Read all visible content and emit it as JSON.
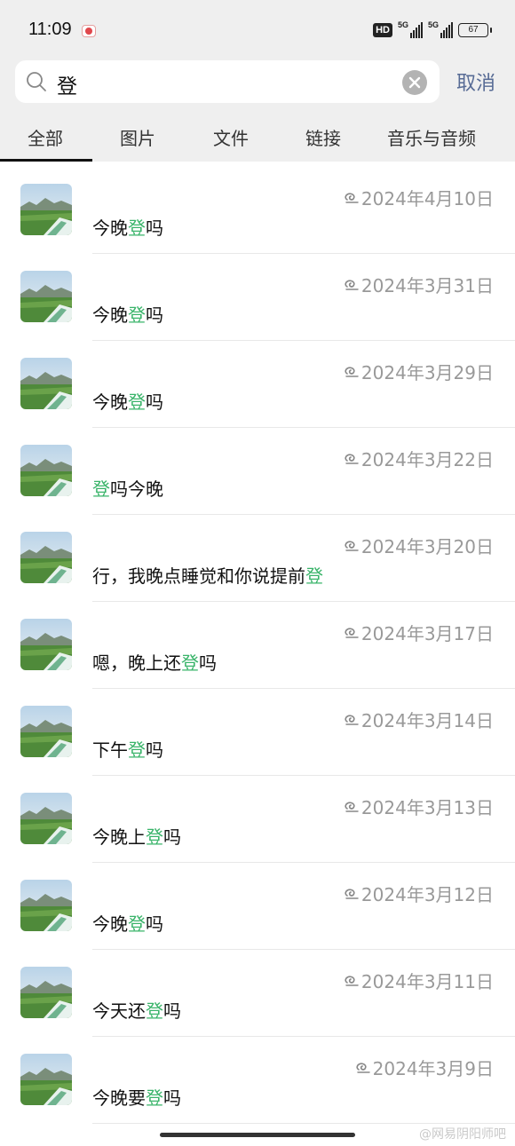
{
  "status_bar": {
    "time": "11:09",
    "hd_badge": "HD",
    "signal1_label": "5G",
    "signal2_label": "5G",
    "battery": "67"
  },
  "search": {
    "query": "登",
    "cancel_label": "取消"
  },
  "tabs": [
    {
      "label": "全部",
      "active": true
    },
    {
      "label": "图片",
      "active": false
    },
    {
      "label": "文件",
      "active": false
    },
    {
      "label": "链接",
      "active": false
    },
    {
      "label": "音乐与音频",
      "active": false
    }
  ],
  "highlight_color": "#3ab46a",
  "results": [
    {
      "date": "2024年4月10日",
      "pre": "今晚",
      "hl": "登",
      "post": "吗"
    },
    {
      "date": "2024年3月31日",
      "pre": "今晚",
      "hl": "登",
      "post": "吗"
    },
    {
      "date": "2024年3月29日",
      "pre": "今晚",
      "hl": "登",
      "post": "吗"
    },
    {
      "date": "2024年3月22日",
      "pre": "",
      "hl": "登",
      "post": "吗今晚"
    },
    {
      "date": "2024年3月20日",
      "pre": "行，我晚点睡觉和你说提前",
      "hl": "登",
      "post": ""
    },
    {
      "date": "2024年3月17日",
      "pre": "嗯，晚上还",
      "hl": "登",
      "post": "吗"
    },
    {
      "date": "2024年3月14日",
      "pre": "下午",
      "hl": "登",
      "post": "吗"
    },
    {
      "date": "2024年3月13日",
      "pre": "今晚上",
      "hl": "登",
      "post": "吗"
    },
    {
      "date": "2024年3月12日",
      "pre": "今晚",
      "hl": "登",
      "post": "吗"
    },
    {
      "date": "2024年3月11日",
      "pre": "今天还",
      "hl": "登",
      "post": "吗"
    },
    {
      "date": "2024年3月9日",
      "pre": "今晚要",
      "hl": "登",
      "post": "吗"
    }
  ],
  "watermark": "@网易阴阳师吧"
}
